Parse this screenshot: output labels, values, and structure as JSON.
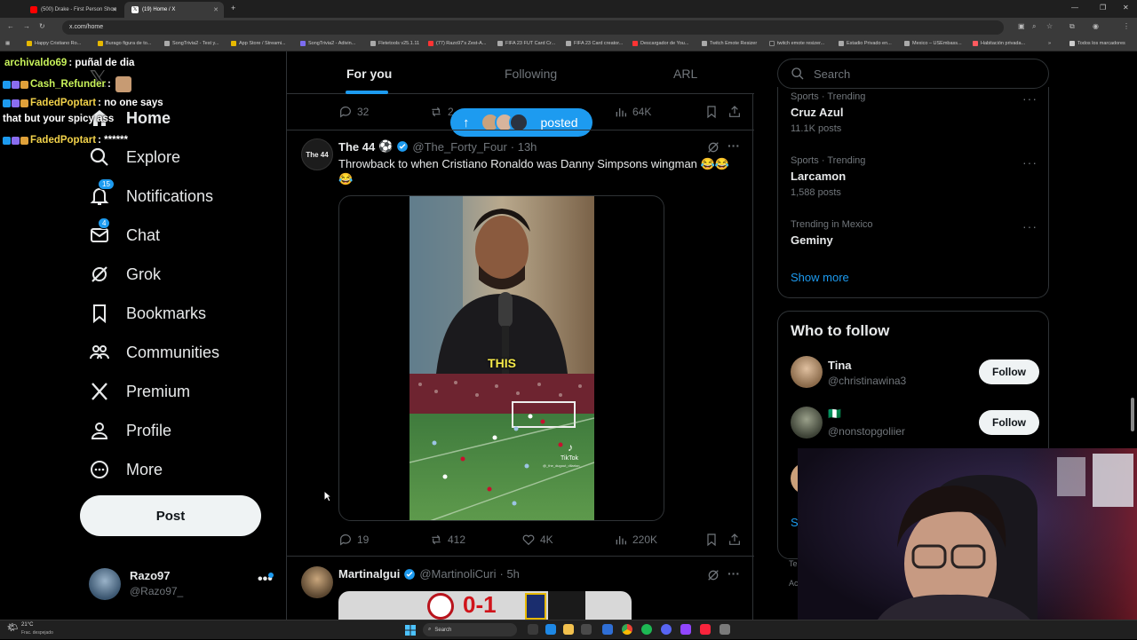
{
  "browser": {
    "tabs": [
      {
        "title": "(500) Drake - First Person Shoo",
        "active": false,
        "favicon_color": "#ff0000"
      },
      {
        "title": "(19) Home / X",
        "active": true,
        "favicon_color": "#ffffff"
      }
    ],
    "url": "x.com/home",
    "bookmarks": [
      "Happy Cristiano Ro...",
      "Burago figura de to...",
      "SongTrivia2 - Test y...",
      "App Store / Streami...",
      "SongTrivia2 - Adivin...",
      "Fletetools v25.1.11",
      "(77) Razo97's Zest-A...",
      "FIFA 23 FUT Card Cr...",
      "FIFA 23 Card creator...",
      "Descargador de You...",
      "Twitch Emote Resizer",
      "twitch emote resizer...",
      "Estadio Privado en...",
      "Mexico – USEmbass...",
      "Habitación privada..."
    ],
    "bookmarks_folder": "Todos los marcadores"
  },
  "chat": [
    {
      "user": "archivaldo69",
      "message": ": puñal de dia"
    },
    {
      "user": "Cash_Refunder",
      "message": ":"
    },
    {
      "user": "FadedPoptart",
      "message": ": no one says",
      "continuation": "that but your spicy ass"
    },
    {
      "user": "FadedPoptart",
      "message": ": ******"
    }
  ],
  "sidebar": {
    "items": [
      {
        "label": "Home",
        "icon": "home-icon"
      },
      {
        "label": "Explore",
        "icon": "search-icon"
      },
      {
        "label": "Notifications",
        "icon": "bell-icon",
        "badge": "15"
      },
      {
        "label": "Chat",
        "icon": "mail-icon",
        "badge": "4"
      },
      {
        "label": "Grok",
        "icon": "grok-icon"
      },
      {
        "label": "Bookmarks",
        "icon": "bookmark-icon"
      },
      {
        "label": "Communities",
        "icon": "people-icon"
      },
      {
        "label": "Premium",
        "icon": "x-logo-icon"
      },
      {
        "label": "Profile",
        "icon": "person-icon"
      },
      {
        "label": "More",
        "icon": "more-circle-icon"
      }
    ],
    "post_label": "Post",
    "account": {
      "name": "Razo97",
      "handle": "@Razo97_"
    }
  },
  "timeline": {
    "tabs": [
      "For you",
      "Following",
      "ARL"
    ],
    "active_tab": "For you",
    "posted_pill": "posted",
    "prev_tweet_stats": {
      "replies": "32",
      "reposts": "2",
      "views": "64K"
    },
    "tweet": {
      "name": "The 44",
      "emoji": "⚽",
      "handle": "@The_Forty_Four",
      "time": "· 13h",
      "avatar_text": "The 44",
      "text": "Throwback to when Cristiano Ronaldo was Danny Simpsons wingman 😂😂😂",
      "video_caption": "THIS",
      "video_watermark": "TikTok",
      "video_watermark_handle": "@_the_dugout_dilarion_",
      "replies": "19",
      "reposts": "412",
      "likes": "4K",
      "views": "220K"
    },
    "next_tweet": {
      "name": "Martinalgui",
      "handle": "@MartinoliCuri",
      "time": "· 5h",
      "score": "0-1"
    }
  },
  "right": {
    "search_placeholder": "Search",
    "trends": [
      {
        "context": "Sports · Trending",
        "topic": "Cruz Azul",
        "count": "11.1K posts"
      },
      {
        "context": "Sports · Trending",
        "topic": "Larcamon",
        "count": "1,588 posts"
      },
      {
        "context": "Trending in Mexico",
        "topic": "Geminy",
        "count": ""
      }
    ],
    "show_more": "Show more",
    "who_to_follow_title": "Who to follow",
    "follow_suggestions": [
      {
        "name": "Tina",
        "handle": "@christinawina3",
        "follow_label": "Follow"
      },
      {
        "name": "🇳🇬",
        "handle": "@nonstopgoliier",
        "follow_label": "Follow"
      }
    ],
    "show_more_partial": "S",
    "footer_partial": [
      "Te",
      "Ac"
    ]
  },
  "taskbar": {
    "weather_temp": "21°C",
    "weather_desc": "Frac. despejado",
    "search_label": "Search"
  },
  "colors": {
    "accent": "#1d9bf0",
    "background": "#000000",
    "border": "#2f3336",
    "secondary_text": "#71767b",
    "chat_username": "#c8f25a"
  }
}
